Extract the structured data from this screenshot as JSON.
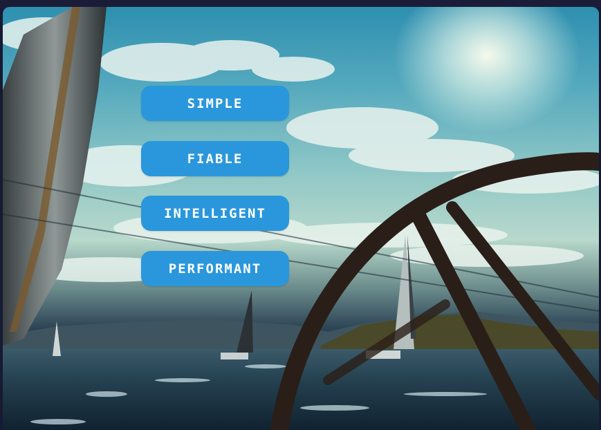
{
  "hero": {
    "image_description_icon": "sailing-photo",
    "accent_color": "#2a97dc"
  },
  "buttons": [
    {
      "label": "SIMPLE"
    },
    {
      "label": "FIABLE"
    },
    {
      "label": "INTELLIGENT"
    },
    {
      "label": "PERFORMANT"
    }
  ]
}
